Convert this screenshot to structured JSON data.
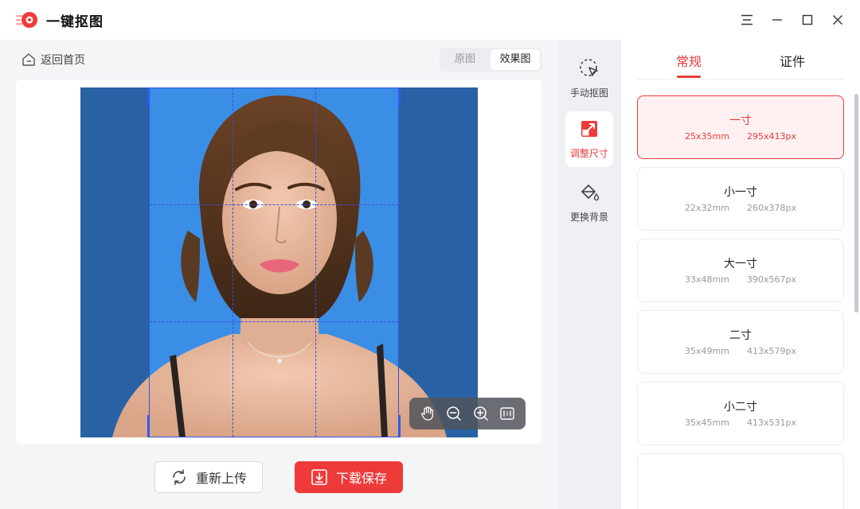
{
  "app": {
    "title": "一键抠图"
  },
  "window_controls": {
    "menu": "menu-icon",
    "minimize": "minimize-icon",
    "maximize": "maximize-icon",
    "close": "close-icon"
  },
  "nav": {
    "back_label": "返回首页"
  },
  "view_toggle": {
    "original": "原图",
    "effect": "效果图",
    "selected": "效果图"
  },
  "zoom_tools": [
    "hand-icon",
    "zoom-out-icon",
    "zoom-in-icon",
    "fit-icon"
  ],
  "actions": {
    "reupload": "重新上传",
    "download": "下载保存"
  },
  "tools": [
    {
      "label": "手动抠图",
      "icon": "cursor-select-icon",
      "active": false
    },
    {
      "label": "调整尺寸",
      "icon": "resize-icon",
      "active": true
    },
    {
      "label": "更换背景",
      "icon": "paint-bucket-icon",
      "active": false
    }
  ],
  "size_tabs": {
    "regular": "常规",
    "id_photo": "证件",
    "selected": "常规"
  },
  "sizes": [
    {
      "name": "一寸",
      "mm": "25x35mm",
      "px": "295x413px",
      "selected": true
    },
    {
      "name": "小一寸",
      "mm": "22x32mm",
      "px": "260x378px",
      "selected": false
    },
    {
      "name": "大一寸",
      "mm": "33x48mm",
      "px": "390x567px",
      "selected": false
    },
    {
      "name": "二寸",
      "mm": "35x49mm",
      "px": "413x579px",
      "selected": false
    },
    {
      "name": "小二寸",
      "mm": "35x45mm",
      "px": "413x531px",
      "selected": false
    }
  ],
  "colors": {
    "accent": "#ef3a3a",
    "photo_bg": "#3a8ee6",
    "crop_line": "#3b4fe0"
  }
}
